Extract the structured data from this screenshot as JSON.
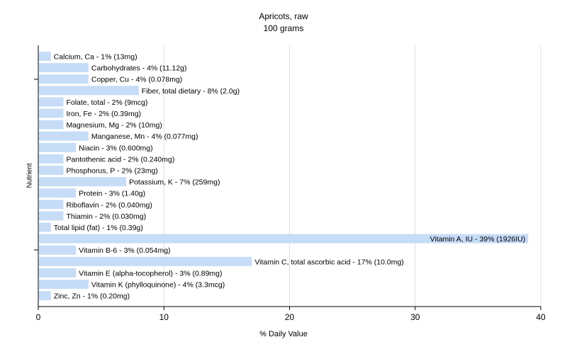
{
  "chart_data": {
    "type": "bar",
    "orientation": "horizontal",
    "title": "Apricots, raw",
    "subtitle": "100 grams",
    "xlabel": "% Daily Value",
    "ylabel": "Nutrient",
    "xlim": [
      0,
      40
    ],
    "xticks": [
      "0",
      "10",
      "20",
      "30",
      "40"
    ],
    "grid": true,
    "bar_color": "#c6dcf7",
    "grid_color": "#e0e0e0",
    "categories": [
      "Calcium, Ca",
      "Carbohydrates",
      "Copper, Cu",
      "Fiber, total dietary",
      "Folate, total",
      "Iron, Fe",
      "Magnesium, Mg",
      "Manganese, Mn",
      "Niacin",
      "Pantothenic acid",
      "Phosphorus, P",
      "Potassium, K",
      "Protein",
      "Riboflavin",
      "Thiamin",
      "Total lipid (fat)",
      "Vitamin A, IU",
      "Vitamin B-6",
      "Vitamin C, total ascorbic acid",
      "Vitamin E (alpha-tocopherol)",
      "Vitamin K (phylloquinone)",
      "Zinc, Zn"
    ],
    "values": [
      1,
      4,
      4,
      8,
      2,
      2,
      2,
      4,
      3,
      2,
      2,
      7,
      3,
      2,
      2,
      1,
      39,
      3,
      17,
      3,
      4,
      1
    ],
    "labels": [
      "Calcium, Ca - 1% (13mg)",
      "Carbohydrates - 4% (11.12g)",
      "Copper, Cu - 4% (0.078mg)",
      "Fiber, total dietary - 8% (2.0g)",
      "Folate, total - 2% (9mcg)",
      "Iron, Fe - 2% (0.39mg)",
      "Magnesium, Mg - 2% (10mg)",
      "Manganese, Mn - 4% (0.077mg)",
      "Niacin - 3% (0.600mg)",
      "Pantothenic acid - 2% (0.240mg)",
      "Phosphorus, P - 2% (23mg)",
      "Potassium, K - 7% (259mg)",
      "Protein - 3% (1.40g)",
      "Riboflavin - 2% (0.040mg)",
      "Thiamin - 2% (0.030mg)",
      "Total lipid (fat) - 1% (0.39g)",
      "Vitamin A, IU - 39% (1926IU)",
      "Vitamin B-6 - 3% (0.054mg)",
      "Vitamin C, total ascorbic acid - 17% (10.0mg)",
      "Vitamin E (alpha-tocopherol) - 3% (0.89mg)",
      "Vitamin K (phylloquinone) - 4% (3.3mcg)",
      "Zinc, Zn - 1% (0.20mg)"
    ]
  }
}
